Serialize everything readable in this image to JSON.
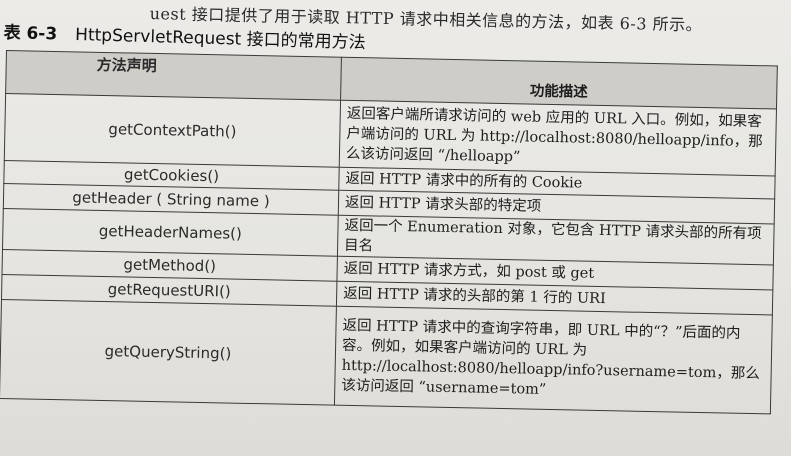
{
  "intro_text": "uest 接口提供了用于读取 HTTP 请求中相关信息的方法，如表 6-3 所示。",
  "caption": {
    "number": "表 6-3",
    "title": "HttpServletRequest 接口的常用方法"
  },
  "table": {
    "headers": [
      "方法声明",
      "功能描述"
    ],
    "rows": [
      {
        "method": "getContextPath()",
        "description": "返回客户端所请求访问的 web 应用的 URL 入口。例如，如果客户端访问的 URL 为 http://localhost:8080/helloapp/info，那么该访问返回 “/helloapp”"
      },
      {
        "method": "getCookies()",
        "description": "返回 HTTP 请求中的所有的 Cookie"
      },
      {
        "method": "getHeader ( String name )",
        "description": "返回 HTTP 请求头部的特定项"
      },
      {
        "method": "getHeaderNames()",
        "description": "返回一个 Enumeration 对象，它包含 HTTP 请求头部的所有项目名"
      },
      {
        "method": "getMethod()",
        "description": "返回 HTTP 请求方式，如 post 或 get"
      },
      {
        "method": "getRequestURI()",
        "description": "返回 HTTP 请求的头部的第 1 行的 URI"
      },
      {
        "method": "getQueryString()",
        "description": "返回 HTTP 请求中的查询字符串，即 URL 中的“？”后面的内容。例如，如果客户端访问的 URL 为 http://localhost:8080/helloapp/info?username=tom，那么该访问返回 “username=tom”"
      }
    ]
  }
}
